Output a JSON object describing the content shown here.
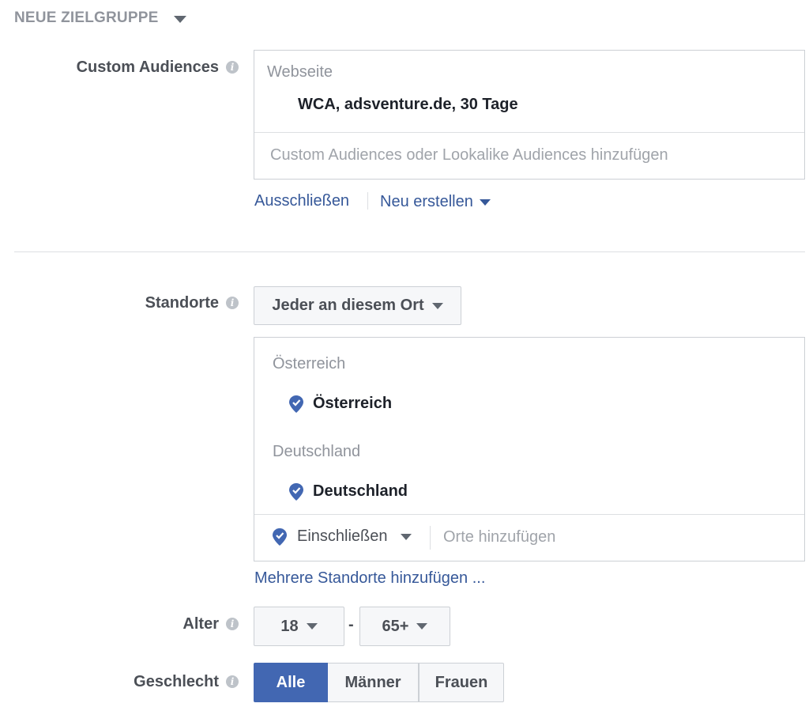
{
  "header": {
    "title": "NEUE ZIELGRUPPE"
  },
  "custom_audiences": {
    "label": "Custom Audiences",
    "group_label": "Webseite",
    "selected_item": "WCA, adsventure.de, 30 Tage",
    "placeholder": "Custom Audiences oder Lookalike Audiences hinzufügen",
    "exclude_link": "Ausschließen",
    "create_new_link": "Neu erstellen"
  },
  "locations": {
    "label": "Standorte",
    "dropdown_value": "Jeder an diesem Ort",
    "groups": [
      {
        "group_label": "Österreich",
        "item": "Österreich"
      },
      {
        "group_label": "Deutschland",
        "item": "Deutschland"
      }
    ],
    "include_value": "Einschließen",
    "add_placeholder": "Orte hinzufügen",
    "add_multiple_link": "Mehrere Standorte hinzufügen ..."
  },
  "age": {
    "label": "Alter",
    "min": "18",
    "separator": "-",
    "max": "65+"
  },
  "gender": {
    "label": "Geschlecht",
    "options": [
      "Alle",
      "Männer",
      "Frauen"
    ],
    "selected": "Alle"
  },
  "colors": {
    "link": "#365899",
    "selected_button": "#4267b2",
    "border": "#ccd0d5",
    "muted_text": "#90949c"
  }
}
